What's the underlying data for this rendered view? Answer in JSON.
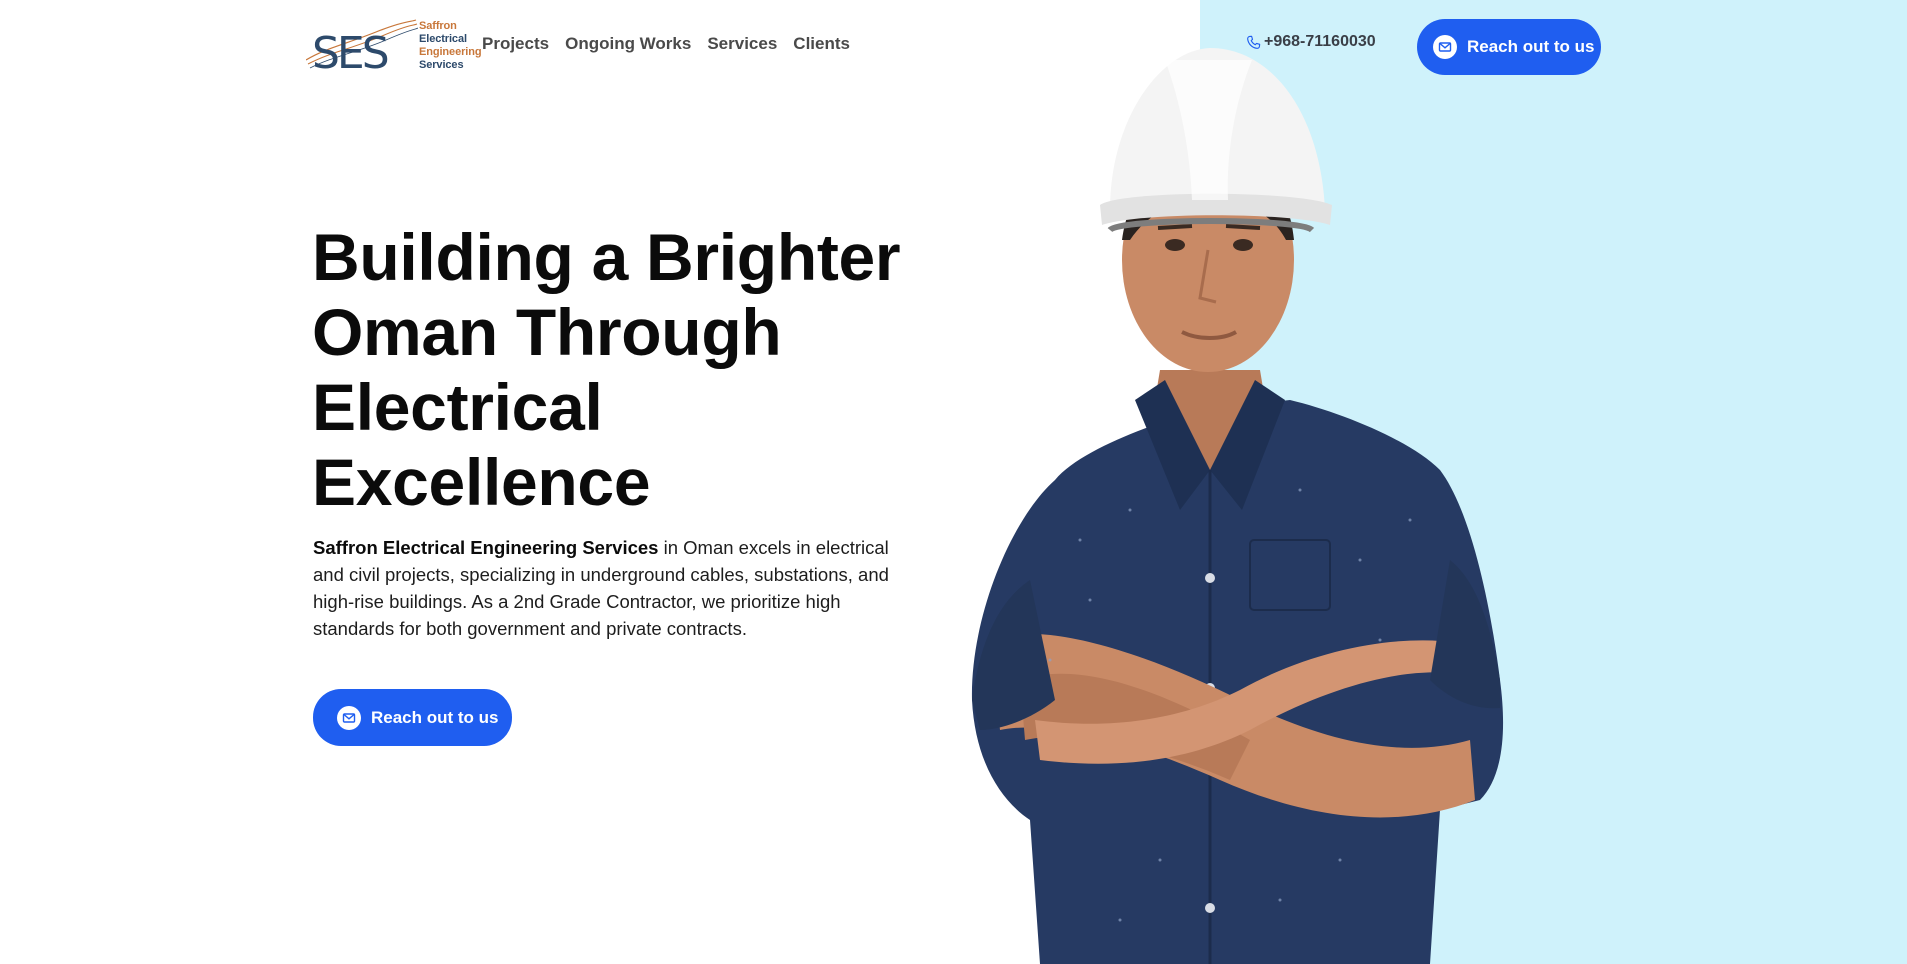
{
  "brand": {
    "logo_letters": "SES",
    "logo_lines": [
      "Saffron",
      "Electrical",
      "Engineering",
      "Services"
    ]
  },
  "nav": {
    "items": [
      "Projects",
      "Ongoing Works",
      "Services",
      "Clients"
    ]
  },
  "contact": {
    "phone": "+968-71160030",
    "phone_icon": "phone-icon"
  },
  "header": {
    "cta_label": "Reach out to us",
    "cta_icon": "envelope-icon"
  },
  "hero": {
    "title_lines": [
      "Building a Brighter",
      "Oman Through",
      "Electrical",
      "Excellence"
    ],
    "desc_strong": "Saffron Electrical Engineering Services",
    "desc_rest": " in Oman excels in electrical and civil projects, specializing in underground cables, substations, and high-rise buildings. As a 2nd Grade Contractor, we prioritize high standards for both government and private contracts.",
    "cta_label": "Reach out to us",
    "cta_icon": "envelope-icon"
  },
  "colors": {
    "accent": "#1f5ef0",
    "panel_bg": "#cff2fb",
    "shirt": "#263a63",
    "helmet": "#f4f4f4",
    "skin": "#c98a66",
    "logo_orange": "#c8773a",
    "logo_navy": "#2d4a6b"
  }
}
